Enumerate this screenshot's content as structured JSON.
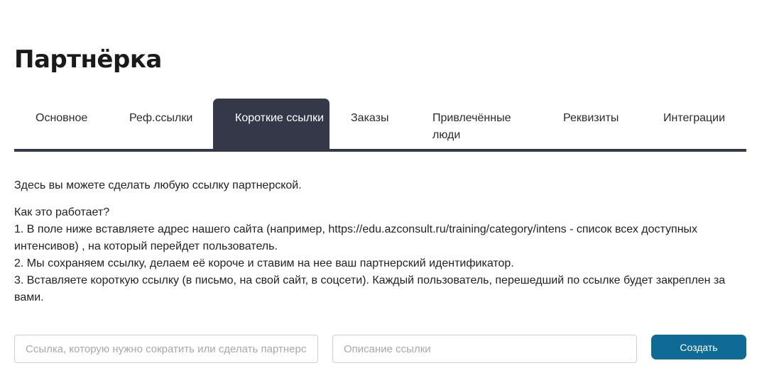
{
  "page": {
    "title": "Партнёрка"
  },
  "tabs": [
    {
      "label": "Основное",
      "active": false
    },
    {
      "label": "Реф.ссылки",
      "active": false
    },
    {
      "label": "Короткие ссылки",
      "active": true
    },
    {
      "label": "Заказы",
      "active": false
    },
    {
      "label": "Привлечённые люди",
      "active": false
    },
    {
      "label": "Реквизиты",
      "active": false
    },
    {
      "label": "Интеграции",
      "active": false
    }
  ],
  "content": {
    "intro": "Здесь вы можете сделать любую ссылку партнерской.",
    "how_title": "Как это работает?",
    "steps": [
      "1. В поле ниже вставляете адрес нашего сайта (например, https://edu.azconsult.ru/training/category/intens - список всех доступных интенсивов) , на который перейдет пользователь.",
      "2. Мы сохраняем ссылку, делаем её короче и ставим на нее ваш партнерский идентификатор.",
      "3. Вставляете короткую ссылку (в письмо, на свой сайт, в соцсети). Каждый пользователь, перешедший по ссылке будет закреплен за вами."
    ]
  },
  "form": {
    "link_input": {
      "value": "",
      "placeholder": "Ссылка, которую нужно сократить или сделать партнерской"
    },
    "description_input": {
      "value": "",
      "placeholder": "Описание ссылки"
    },
    "create_label": "Создать"
  },
  "colors": {
    "tab_active_bg": "#353848",
    "accent_button": "#0f6a96"
  }
}
